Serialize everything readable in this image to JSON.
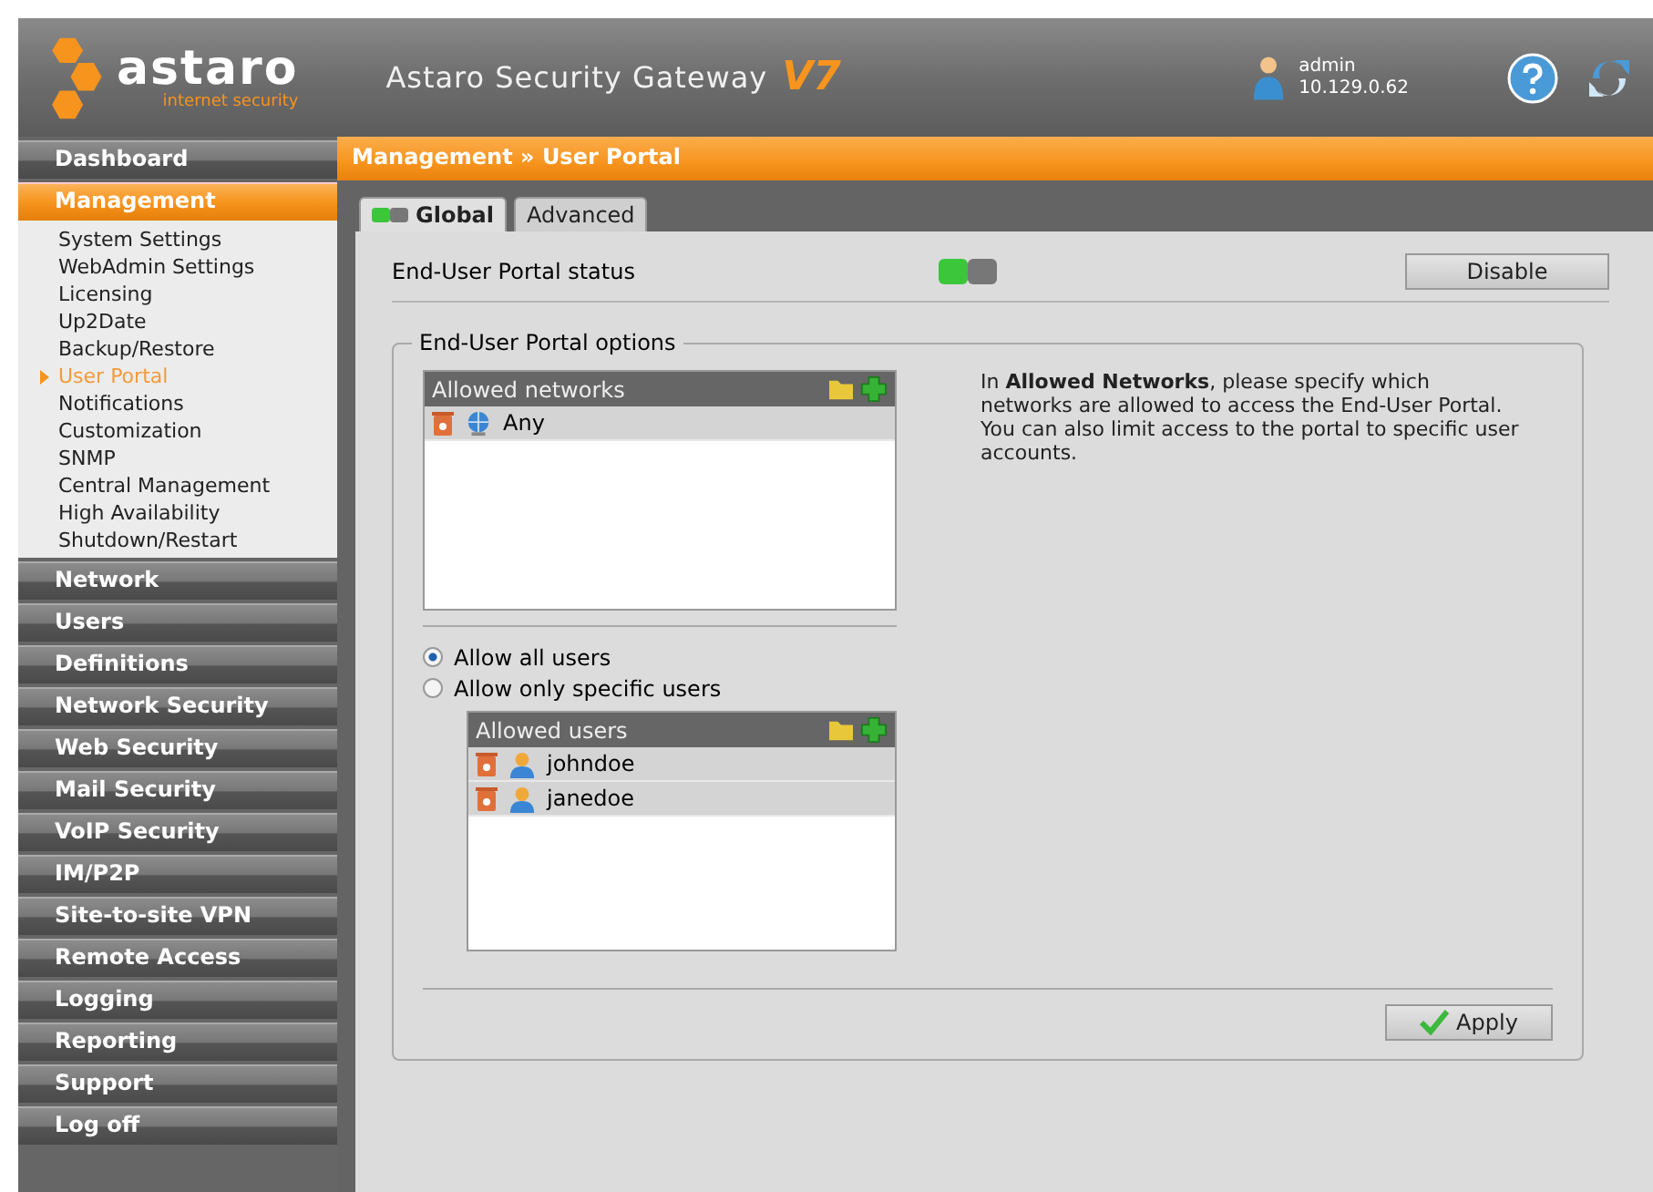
{
  "header": {
    "logo": "astaro",
    "logo_tagline": "internet security",
    "product": "Astaro Security Gateway",
    "version": "V7",
    "user": "admin",
    "ip": "10.129.0.62"
  },
  "sidebar": {
    "items": [
      {
        "label": "Dashboard",
        "selected": false
      },
      {
        "label": "Management",
        "selected": true,
        "children": [
          {
            "label": "System Settings",
            "selected": false
          },
          {
            "label": "WebAdmin Settings",
            "selected": false
          },
          {
            "label": "Licensing",
            "selected": false
          },
          {
            "label": "Up2Date",
            "selected": false
          },
          {
            "label": "Backup/Restore",
            "selected": false
          },
          {
            "label": "User Portal",
            "selected": true
          },
          {
            "label": "Notifications",
            "selected": false
          },
          {
            "label": "Customization",
            "selected": false
          },
          {
            "label": "SNMP",
            "selected": false
          },
          {
            "label": "Central Management",
            "selected": false
          },
          {
            "label": "High Availability",
            "selected": false
          },
          {
            "label": "Shutdown/Restart",
            "selected": false
          }
        ]
      },
      {
        "label": "Network",
        "selected": false
      },
      {
        "label": "Users",
        "selected": false
      },
      {
        "label": "Definitions",
        "selected": false
      },
      {
        "label": "Network Security",
        "selected": false
      },
      {
        "label": "Web Security",
        "selected": false
      },
      {
        "label": "Mail Security",
        "selected": false
      },
      {
        "label": "VoIP Security",
        "selected": false
      },
      {
        "label": "IM/P2P",
        "selected": false
      },
      {
        "label": "Site-to-site VPN",
        "selected": false
      },
      {
        "label": "Remote Access",
        "selected": false
      },
      {
        "label": "Logging",
        "selected": false
      },
      {
        "label": "Reporting",
        "selected": false
      },
      {
        "label": "Support",
        "selected": false
      },
      {
        "label": "Log off",
        "selected": false
      }
    ]
  },
  "breadcrumb": "Management » User Portal",
  "tabs": [
    {
      "label": "Global",
      "selected": true
    },
    {
      "label": "Advanced",
      "selected": false
    }
  ],
  "status": {
    "label": "End-User Portal status",
    "on": true,
    "button": "Disable"
  },
  "options": {
    "legend": "End-User Portal options",
    "networks": {
      "title": "Allowed networks",
      "items": [
        {
          "name": "Any",
          "kind": "network"
        }
      ]
    },
    "description": "In **Allowed Networks**, please specify which networks are allowed to access the End-User Portal. You can also limit access to the portal to specific user accounts.",
    "radios": [
      {
        "label": "Allow all users",
        "selected": true
      },
      {
        "label": "Allow only specific users",
        "selected": false
      }
    ],
    "users": {
      "title": "Allowed users",
      "items": [
        {
          "name": "johndoe",
          "kind": "user"
        },
        {
          "name": "janedoe",
          "kind": "user"
        }
      ]
    },
    "apply": "Apply"
  }
}
